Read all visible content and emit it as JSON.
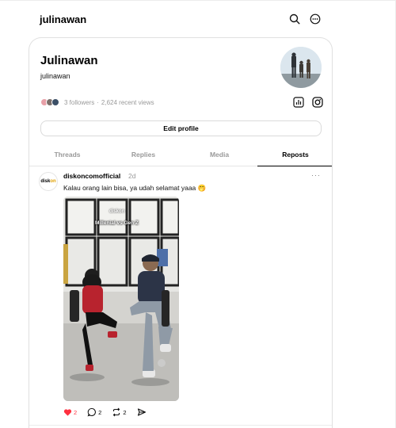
{
  "header": {
    "brand": "julinawan"
  },
  "profile": {
    "name": "Julinawan",
    "handle": "julinawan",
    "followers_text": "3 followers",
    "separator": "·",
    "views_text": "2,624 recent views",
    "edit_label": "Edit profile"
  },
  "tabs": [
    {
      "label": "Threads",
      "active": false
    },
    {
      "label": "Replies",
      "active": false
    },
    {
      "label": "Media",
      "active": false
    },
    {
      "label": "Reposts",
      "active": true
    }
  ],
  "post": {
    "avatar_text_1": "disk",
    "avatar_text_2": "on",
    "username": "diskoncomofficial",
    "time": "2d",
    "more": "···",
    "text": "Kalau orang lain bisa, ya udah selamat yaaa 🤭",
    "video_caption": "Millenial vs Gen Z",
    "video_logo": "diskon",
    "likes": "2",
    "replies": "2",
    "reposts": "2"
  },
  "colors": {
    "like": "#ff3040",
    "muted": "#999999",
    "border": "#e0e0e0"
  },
  "icons": [
    "search-icon",
    "more-circle-icon",
    "insights-icon",
    "instagram-icon",
    "heart-icon",
    "comment-icon",
    "repost-icon",
    "share-icon"
  ]
}
